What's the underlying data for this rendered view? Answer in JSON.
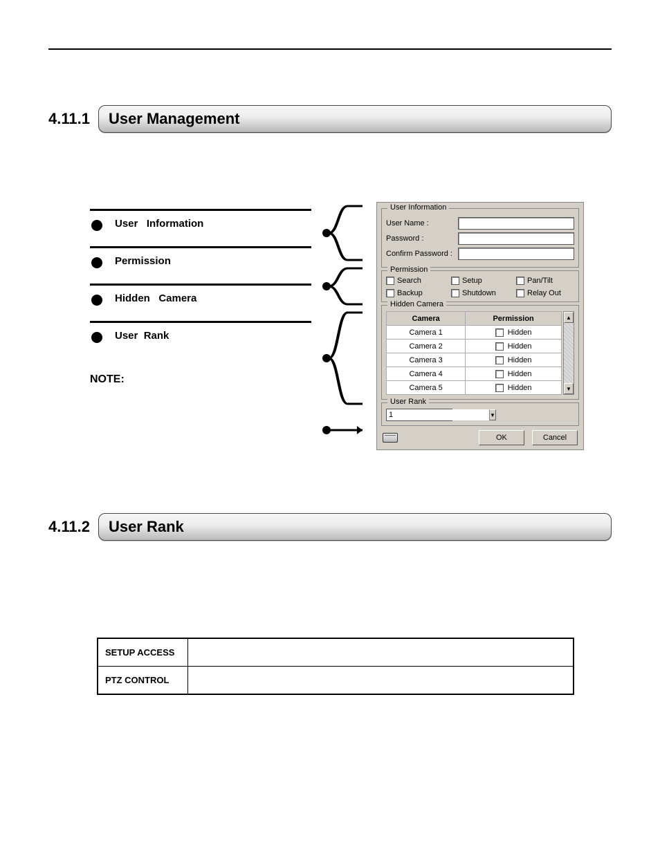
{
  "section1": {
    "number": "4.11.1",
    "title": "User Management"
  },
  "section2": {
    "number": "4.11.2",
    "title": "User Rank"
  },
  "left_bullets": {
    "b0": "User   Information",
    "b1": "Permission",
    "b2": "Hidden   Camera",
    "b3": "User  Rank"
  },
  "note_label": "NOTE:",
  "dialog": {
    "group_userinfo": "User Information",
    "label_username": "User Name :",
    "label_password": "Password :",
    "label_confirm": "Confirm Password :",
    "val_username": "",
    "val_password": "",
    "val_confirm": "",
    "group_permission": "Permission",
    "perm": {
      "search": "Search",
      "setup": "Setup",
      "pantilt": "Pan/Tilt",
      "backup": "Backup",
      "shutdown": "Shutdown",
      "relayout": "Relay Out"
    },
    "group_hidden": "Hidden Camera",
    "tbl_head_camera": "Camera",
    "tbl_head_permission": "Permission",
    "cameras": {
      "c1": "Camera 1",
      "c2": "Camera 2",
      "c3": "Camera 3",
      "c4": "Camera 4",
      "c5": "Camera 5"
    },
    "hidden_label": "Hidden",
    "group_rank": "User Rank",
    "rank_value": "1",
    "btn_ok": "OK",
    "btn_cancel": "Cancel"
  },
  "rank_table": {
    "row1": "SETUP ACCESS",
    "row2": "PTZ CONTROL"
  }
}
